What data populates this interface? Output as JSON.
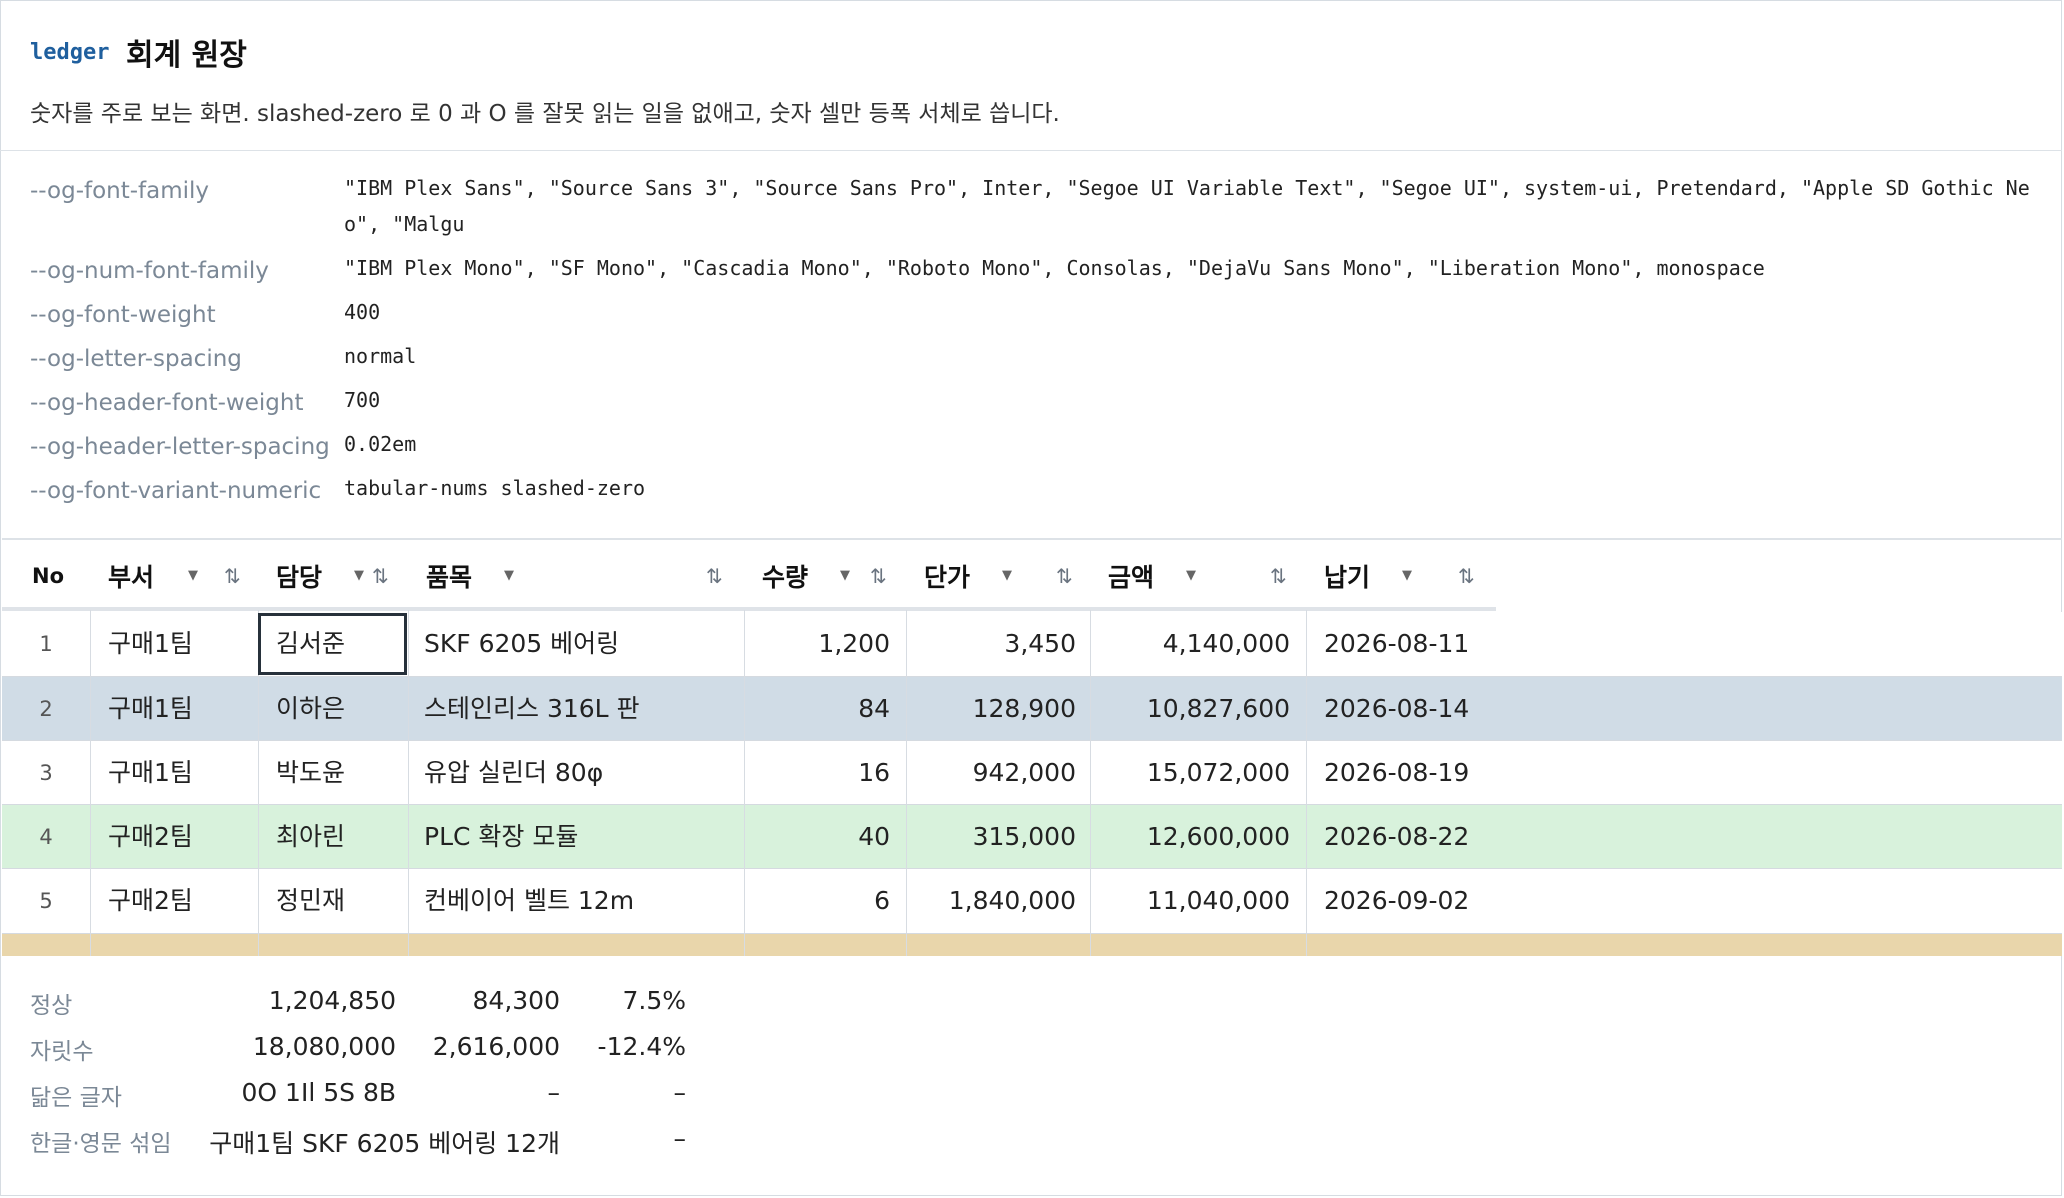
{
  "header": {
    "badge": "ledger",
    "title": "회계 원장",
    "subtitle": "숫자를 주로 보는 화면. slashed-zero 로 0 과 O 를 잘못 읽는 일을 없애고, 숫자 셀만 등폭 서체로 씁니다."
  },
  "props": [
    {
      "key": "--og-font-family",
      "value": "\"IBM Plex Sans\", \"Source Sans 3\", \"Source Sans Pro\", Inter, \"Segoe UI Variable Text\", \"Segoe UI\", system-ui, Pretendard, \"Apple SD Gothic Neo\", \"Malgu"
    },
    {
      "key": "--og-num-font-family",
      "value": "\"IBM Plex Mono\", \"SF Mono\", \"Cascadia Mono\", \"Roboto Mono\", Consolas, \"DejaVu Sans Mono\", \"Liberation Mono\", monospace"
    },
    {
      "key": "--og-font-weight",
      "value": "400"
    },
    {
      "key": "--og-letter-spacing",
      "value": "normal"
    },
    {
      "key": "--og-header-font-weight",
      "value": "700"
    },
    {
      "key": "--og-header-letter-spacing",
      "value": "0.02em"
    },
    {
      "key": "--og-font-variant-numeric",
      "value": "tabular-nums slashed-zero"
    }
  ],
  "table": {
    "columns": [
      {
        "label": "No"
      },
      {
        "label": "부서",
        "filter_icon": "dropdown-arrow-icon",
        "sort_icon": "sort-arrows-icon"
      },
      {
        "label": "담당",
        "filter_icon": "dropdown-arrow-icon",
        "sort_icon": "sort-arrows-icon"
      },
      {
        "label": "품목",
        "filter_icon": "dropdown-arrow-icon",
        "sort_icon": "sort-arrows-icon"
      },
      {
        "label": "수량",
        "filter_icon": "dropdown-arrow-icon",
        "sort_icon": "sort-arrows-icon"
      },
      {
        "label": "단가",
        "filter_icon": "dropdown-arrow-icon",
        "sort_icon": "sort-arrows-icon"
      },
      {
        "label": "금액",
        "filter_icon": "dropdown-arrow-icon",
        "sort_icon": "sort-arrows-icon"
      },
      {
        "label": "납기",
        "filter_icon": "dropdown-arrow-icon",
        "sort_icon": "sort-arrows-icon"
      }
    ],
    "rows": [
      {
        "no": "1",
        "dept": "구매1팀",
        "owner": "김서준",
        "item": "SKF 6205 베어링",
        "qty": "1,200",
        "price": "3,450",
        "amount": "4,140,000",
        "due": "2026-08-11",
        "bg": "#ffffff"
      },
      {
        "no": "2",
        "dept": "구매1팀",
        "owner": "이하은",
        "item": "스테인리스 316L 판",
        "qty": "84",
        "price": "128,900",
        "amount": "10,827,600",
        "due": "2026-08-14",
        "bg": "#d0dce6"
      },
      {
        "no": "3",
        "dept": "구매1팀",
        "owner": "박도윤",
        "item": "유압 실린더 80φ",
        "qty": "16",
        "price": "942,000",
        "amount": "15,072,000",
        "due": "2026-08-19",
        "bg": "#ffffff"
      },
      {
        "no": "4",
        "dept": "구매2팀",
        "owner": "최아린",
        "item": "PLC 확장 모듈",
        "qty": "40",
        "price": "315,000",
        "amount": "12,600,000",
        "due": "2026-08-22",
        "bg": "#d8f2dc"
      },
      {
        "no": "5",
        "dept": "구매2팀",
        "owner": "정민재",
        "item": "컨베이어 벨트 12m",
        "qty": "6",
        "price": "1,840,000",
        "amount": "11,040,000",
        "due": "2026-09-02",
        "bg": "#ffffff"
      }
    ],
    "selected_cell": "김서준",
    "total_row_color": "#e9d6ab"
  },
  "summary": [
    {
      "label": "정상",
      "a": "1,204,850",
      "b": "84,300",
      "c": "7.5%"
    },
    {
      "label": "자릿수",
      "a": "18,080,000",
      "b": "2,616,000",
      "c": "-12.4%"
    },
    {
      "label": "닮은 글자",
      "a": "0O 1Il 5S 8B",
      "b": "–",
      "c": "–"
    },
    {
      "label": "한글·영문 섞임",
      "a": "구매1팀 SKF 6205 베어링 12개",
      "b": "",
      "c": "–"
    }
  ]
}
